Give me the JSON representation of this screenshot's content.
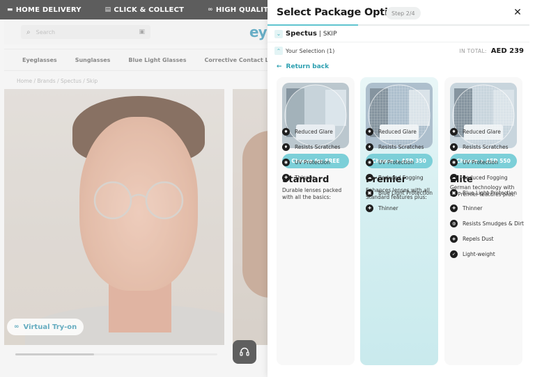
{
  "promo": {
    "items": [
      {
        "icon": "truck-icon",
        "label": "HOME DELIVERY"
      },
      {
        "icon": "store-icon",
        "label": "CLICK & COLLECT"
      },
      {
        "icon": "glasses-icon",
        "label": "HIGH QUALITY"
      }
    ]
  },
  "site": {
    "search_placeholder": "Search",
    "logo_fragment": "ey",
    "nav": [
      "Eyeglasses",
      "Sunglasses",
      "Blue Light Glasses",
      "Corrective Contact Lenses",
      "Co"
    ],
    "breadcrumb": "Home / Brands / Spectus / Skip",
    "virtual_tryon": "Virtual Try-on",
    "carousel_progress": 0.39
  },
  "drawer": {
    "title": "Select Package Option",
    "step": "Step 2/4",
    "step_progress": 0.345,
    "brand": "Spectus",
    "product": "| SKIP",
    "selection_label": "Your Selection (1)",
    "total_label": "IN TOTAL:",
    "total_value": "AED 239",
    "back_label": "Return back"
  },
  "packages": [
    {
      "id": "standard",
      "button": "Choose for FREE",
      "name": "Standard",
      "description": "Durable lenses packed with all the basics:",
      "features": [
        {
          "icon": "reduced-glare-icon",
          "glyph": "✸",
          "label": "Reduced Glare"
        },
        {
          "icon": "scratch-shield-icon",
          "glyph": "♦",
          "label": "Resists Scratches"
        },
        {
          "icon": "uv-icon",
          "glyph": "◉",
          "label": "UV Protection"
        },
        {
          "icon": "thin-lens-icon",
          "glyph": "✚",
          "label": "Thinner"
        }
      ]
    },
    {
      "id": "premier",
      "button": "Choose + AED 350",
      "name": "Premier",
      "description": "Enhances lenses with all Standard features plus:",
      "features": [
        {
          "icon": "reduced-glare-icon",
          "glyph": "✸",
          "label": "Reduced Glare"
        },
        {
          "icon": "scratch-shield-icon",
          "glyph": "♦",
          "label": "Resists Scratches"
        },
        {
          "icon": "uv-icon",
          "glyph": "◉",
          "label": "UV Protection"
        },
        {
          "icon": "anti-fog-icon",
          "glyph": "☁",
          "label": "Reduced Fogging"
        },
        {
          "icon": "blue-light-icon",
          "glyph": "▣",
          "label": "Blue Light Protection"
        },
        {
          "icon": "thin-lens-icon",
          "glyph": "✚",
          "label": "Thinner"
        }
      ]
    },
    {
      "id": "elite",
      "button": "Choose + AED 550",
      "name": "Elite",
      "description": "German technology with all Premier features plus:",
      "features": [
        {
          "icon": "reduced-glare-icon",
          "glyph": "✸",
          "label": "Reduced Glare"
        },
        {
          "icon": "scratch-shield-icon",
          "glyph": "♦",
          "label": "Resists Scratches"
        },
        {
          "icon": "uv-icon",
          "glyph": "◉",
          "label": "UV Protection"
        },
        {
          "icon": "anti-fog-icon",
          "glyph": "☁",
          "label": "Reduced Fogging"
        },
        {
          "icon": "blue-light-icon",
          "glyph": "▣",
          "label": "Blue Light Protection"
        },
        {
          "icon": "thin-lens-icon",
          "glyph": "✚",
          "label": "Thinner"
        },
        {
          "icon": "anti-smudge-icon",
          "glyph": "◍",
          "label": "Resists Smudges & Dirt"
        },
        {
          "icon": "dust-repel-icon",
          "glyph": "◈",
          "label": "Repels Dust"
        },
        {
          "icon": "feather-icon",
          "glyph": "➶",
          "label": "Light-weight"
        }
      ]
    }
  ],
  "colors": {
    "accent": "#7ccfd8",
    "link": "#2c9fb0",
    "premium_card": "#d5eff1"
  }
}
